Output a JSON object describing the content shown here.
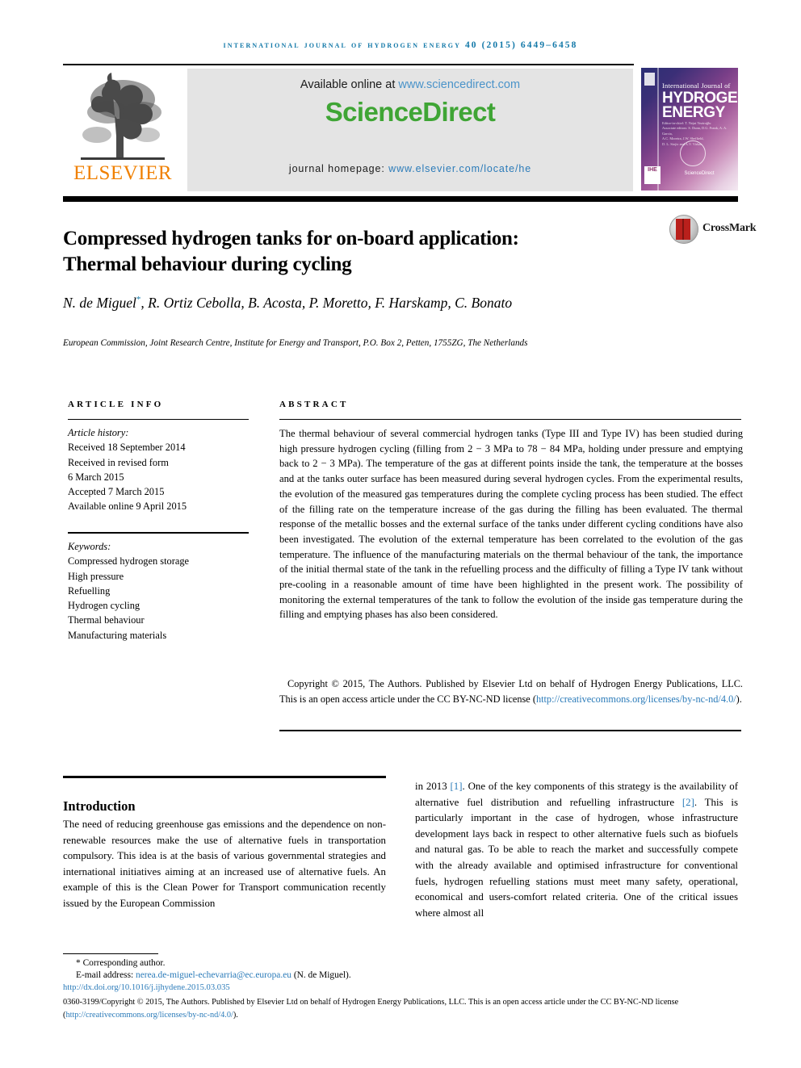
{
  "running_head": "international journal of hydrogen energy 40 (2015) 6449–6458",
  "masthead": {
    "publisher_name": "ELSEVIER",
    "available_prefix": "Available online at ",
    "available_link": "www.sciencedirect.com",
    "sciencedirect_part1": "Science",
    "sciencedirect_part2": "Direct",
    "homepage_prefix": "journal homepage: ",
    "homepage_link": "www.elsevier.com/locate/he",
    "cover": {
      "line1": "International Journal of",
      "line2": "HYDROGEN",
      "line3": "ENERGY",
      "editors": "Editor-in-chief:  T. Nejat Veziroğlu\nAssociate editors:  S. Dunn, D.G. Frank, A. A. Garcia,\nA.C. Moreira, J.W. Sheffield,\nD. L. Stojic and A.V. Virkar",
      "society_mark": "IHE",
      "science_direct": "ScienceDirect"
    }
  },
  "article": {
    "title": "Compressed hydrogen tanks for on-board application: Thermal behaviour during cycling",
    "crossmark_label": "CrossMark",
    "authors": "N. de Miguel*, R. Ortiz Cebolla, B. Acosta, P. Moretto, F. Harskamp, C. Bonato",
    "affiliation": "European Commission, Joint Research Centre, Institute for Energy and Transport, P.O. Box 2, Petten, 1755ZG, The Netherlands"
  },
  "article_info": {
    "heading": "ARTICLE INFO",
    "history_label": "Article history:",
    "history": [
      "Received 18 September 2014",
      "Received in revised form",
      "6 March 2015",
      "Accepted 7 March 2015",
      "Available online 9 April 2015"
    ],
    "keywords_label": "Keywords:",
    "keywords": [
      "Compressed hydrogen storage",
      "High pressure",
      "Refuelling",
      "Hydrogen cycling",
      "Thermal behaviour",
      "Manufacturing materials"
    ]
  },
  "abstract": {
    "heading": "ABSTRACT",
    "text": "The thermal behaviour of several commercial hydrogen tanks (Type III and Type IV) has been studied during high pressure hydrogen cycling (filling from 2 − 3 MPa to 78 − 84 MPa, holding under pressure and emptying back to 2 − 3 MPa). The temperature of the gas at different points inside the tank, the temperature at the bosses and at the tanks outer surface has been measured during several hydrogen cycles. From the experimental results, the evolution of the measured gas temperatures during the complete cycling process has been studied. The effect of the filling rate on the temperature increase of the gas during the filling has been evaluated. The thermal response of the metallic bosses and the external surface of the tanks under different cycling conditions have also been investigated. The evolution of the external temperature has been correlated to the evolution of the gas temperature. The influence of the manufacturing materials on the thermal behaviour of the tank, the importance of the initial thermal state of the tank in the refuelling process and the difficulty of filling a Type IV tank without pre-cooling in a reasonable amount of time have been highlighted in the present work. The possibility of monitoring the external temperatures of the tank to follow the evolution of the inside gas temperature during the filling and emptying phases has also been considered.",
    "copyright_text": "Copyright © 2015, The Authors. Published by Elsevier Ltd on behalf of Hydrogen Energy Publications, LLC. This is an open access article under the CC BY-NC-ND license (",
    "copyright_link": "http://creativecommons.org/licenses/by-nc-nd/4.0/",
    "copyright_tail": ")."
  },
  "body": {
    "section_title": "Introduction",
    "left_column": "The need of reducing greenhouse gas emissions and the dependence on non-renewable resources make the use of alternative fuels in transportation compulsory. This idea is at the basis of various governmental strategies and international initiatives aiming at an increased use of alternative fuels. An example of this is the Clean Power for Transport communication recently issued by the European Commission",
    "right_column_pre": "in 2013 ",
    "right_ref1": "[1]",
    "right_column_mid": ". One of the key components of this strategy is the availability of alternative fuel distribution and refuelling infrastructure ",
    "right_ref2": "[2]",
    "right_column_post": ". This is particularly important in the case of hydrogen, whose infrastructure development lays back in respect to other alternative fuels such as biofuels and natural gas. To be able to reach the market and successfully compete with the already available and optimised infrastructure for conventional fuels, hydrogen refuelling stations must meet many safety, operational, economical and users-comfort related criteria. One of the critical issues where almost all"
  },
  "footnote": {
    "corresponding_marker": "*",
    "corresponding_text": "Corresponding author.",
    "email_label": "E-mail address: ",
    "email_link": "nerea.de-miguel-echevarria@ec.europa.eu",
    "email_tail": " (N. de Miguel).",
    "doi": "http://dx.doi.org/10.1016/j.ijhydene.2015.03.035",
    "copyright_line1": "0360-3199/Copyright © 2015, The Authors. Published by Elsevier Ltd on behalf of Hydrogen Energy Publications, LLC. This is an open access article under the",
    "copyright_line2_pre": "CC BY-NC-ND license (",
    "copyright_line2_link": "http://creativecommons.org/licenses/by-nc-nd/4.0/",
    "copyright_line2_tail": ")."
  },
  "colors": {
    "journal_head": "#1278a8",
    "link": "#2b7bb9",
    "sciencedirect_green": "#3fa535",
    "elsevier_orange": "#f08000",
    "banner_gray": "#e4e4e4"
  }
}
